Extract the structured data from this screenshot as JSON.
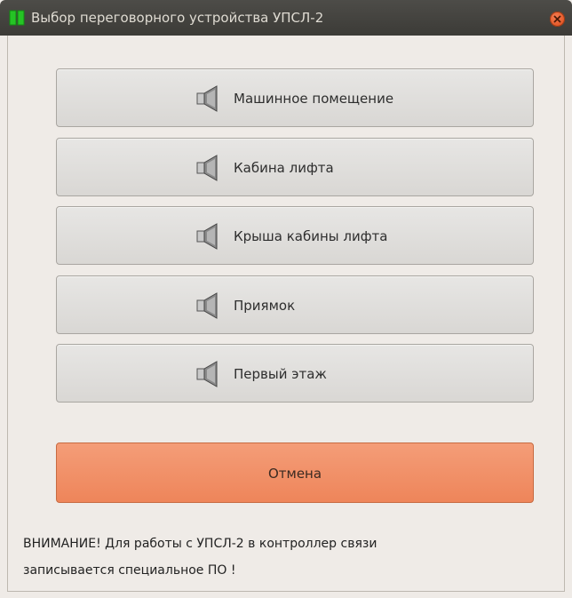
{
  "window": {
    "title": "Выбор переговорного устройства УПСЛ-2",
    "app_icon": "green-bars-icon",
    "close_icon": "close-icon"
  },
  "devices": [
    {
      "label": "Машинное помещение",
      "icon": "speaker-icon"
    },
    {
      "label": "Кабина лифта",
      "icon": "speaker-icon"
    },
    {
      "label": "Крыша кабины лифта",
      "icon": "speaker-icon"
    },
    {
      "label": "Приямок",
      "icon": "speaker-icon"
    },
    {
      "label": "Первый этаж",
      "icon": "speaker-icon"
    }
  ],
  "cancel": {
    "label": "Отмена",
    "color": "#ef8a5f"
  },
  "warning": {
    "line1": "ВНИМАНИЕ! Для работы с УПСЛ-2 в контроллер связи",
    "line2": "записывается специальное ПО !"
  },
  "colors": {
    "titlebar": "#3c3b37",
    "window_bg": "#efebe7",
    "close": "#dd4814"
  }
}
